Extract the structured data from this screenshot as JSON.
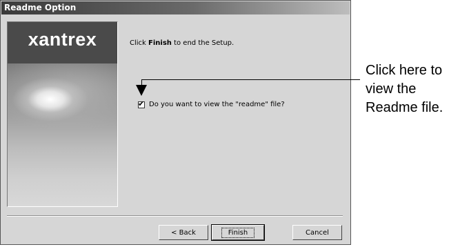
{
  "window": {
    "title": "Readme Option"
  },
  "banner": {
    "logo_text": "xantrex"
  },
  "content": {
    "intro_prefix": "Click ",
    "intro_bold": "Finish",
    "intro_suffix": " to end the Setup.",
    "checkbox": {
      "label": "Do you want to view the \"readme\" file?",
      "checked": true
    }
  },
  "buttons": {
    "back": "< Back",
    "finish": "Finish",
    "cancel": "Cancel"
  },
  "annotation": {
    "text": "Click here to view the Readme file."
  }
}
